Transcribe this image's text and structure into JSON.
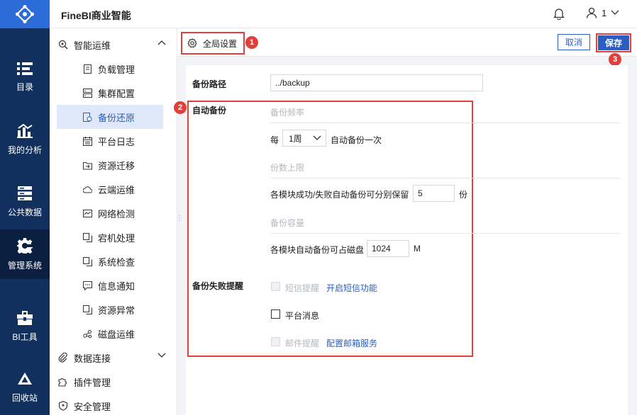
{
  "app": {
    "title": "FineBI商业智能",
    "user": "1"
  },
  "rail": [
    {
      "label": "目录",
      "icon": "catalog-icon"
    },
    {
      "label": "我的分析",
      "icon": "analysis-icon"
    },
    {
      "label": "公共数据",
      "icon": "public-data-icon"
    },
    {
      "label": "管理系统",
      "icon": "gear-icon",
      "active": true
    },
    {
      "label": "BI工具",
      "icon": "toolbox-icon"
    },
    {
      "label": "回收站",
      "icon": "recycle-icon"
    }
  ],
  "nav": {
    "group_ops": "智能运维",
    "items": [
      "负载管理",
      "集群配置",
      "备份还原",
      "平台日志",
      "资源迁移",
      "云端运维",
      "网络检测",
      "宕机处理",
      "系统检查",
      "信息通知",
      "资源异常",
      "磁盘运维"
    ],
    "group_data": "数据连接",
    "plugin": "插件管理",
    "security": "安全管理"
  },
  "header": {
    "global_settings": "全局设置",
    "cancel": "取消",
    "save": "保存",
    "badges": [
      "1",
      "2",
      "3"
    ]
  },
  "form": {
    "path_label": "备份路径",
    "path_value": "../backup",
    "auto_backup_label": "自动备份",
    "freq_title": "备份频率",
    "every": "每",
    "freq_value": "1周",
    "freq_suffix": "自动备份一次",
    "limit_title": "份数上限",
    "limit_text": "各模块成功/失败自动备份可分别保留",
    "limit_value": "5",
    "limit_unit": "份",
    "capacity_title": "备份容量",
    "capacity_text": "各模块自动备份可占磁盘",
    "capacity_value": "1024",
    "capacity_unit": "M",
    "fail_label": "备份失败提醒",
    "sms_label": "短信提醒",
    "sms_link": "开启短信功能",
    "platform_label": "平台消息",
    "email_label": "邮件提醒",
    "email_link": "配置邮箱服务"
  },
  "colors": {
    "rail": "#12305e",
    "accent": "#2a5fc1",
    "highlight": "#e0403a"
  }
}
